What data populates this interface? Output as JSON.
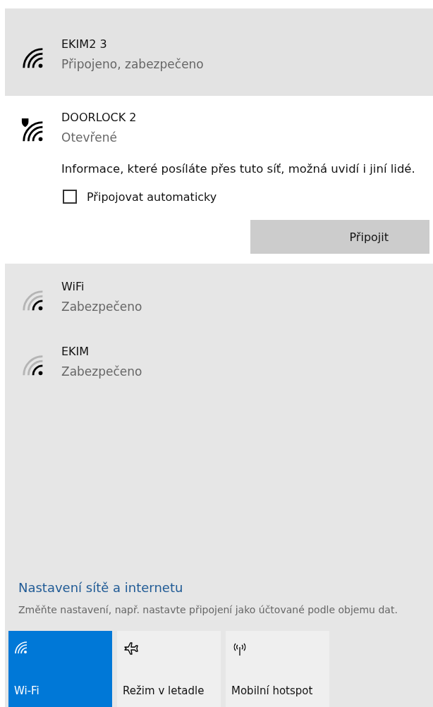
{
  "networks": [
    {
      "name": "EKIM2 3",
      "status": "Připojeno, zabezpečeno",
      "kind": "strong",
      "selected": false,
      "connected": true
    },
    {
      "name": "DOORLOCK 2",
      "status": "Otevřené",
      "kind": "open",
      "selected": true,
      "connected": false,
      "warning": "Informace, které posíláte přes tuto síť, možná uvidí i jiní lidé.",
      "auto_connect": {
        "label": "Připojovat automaticky",
        "checked": false
      },
      "button": "Připojit"
    },
    {
      "name": "WiFi",
      "status": "Zabezpečeno",
      "kind": "weak",
      "selected": false,
      "connected": false
    },
    {
      "name": "EKIM",
      "status": "Zabezpečeno",
      "kind": "weak",
      "selected": false,
      "connected": false
    }
  ],
  "settings": {
    "link": "Nastavení sítě a internetu",
    "description": "Změňte nastavení, např. nastavte připojení jako účtované podle objemu dat."
  },
  "quick_actions": [
    {
      "label": "Wi-Fi",
      "kind": "wifi",
      "on": true
    },
    {
      "label": "Režim v letadle",
      "kind": "airplane",
      "on": false
    },
    {
      "label": "Mobilní hotspot",
      "kind": "hotspot",
      "on": false
    }
  ]
}
